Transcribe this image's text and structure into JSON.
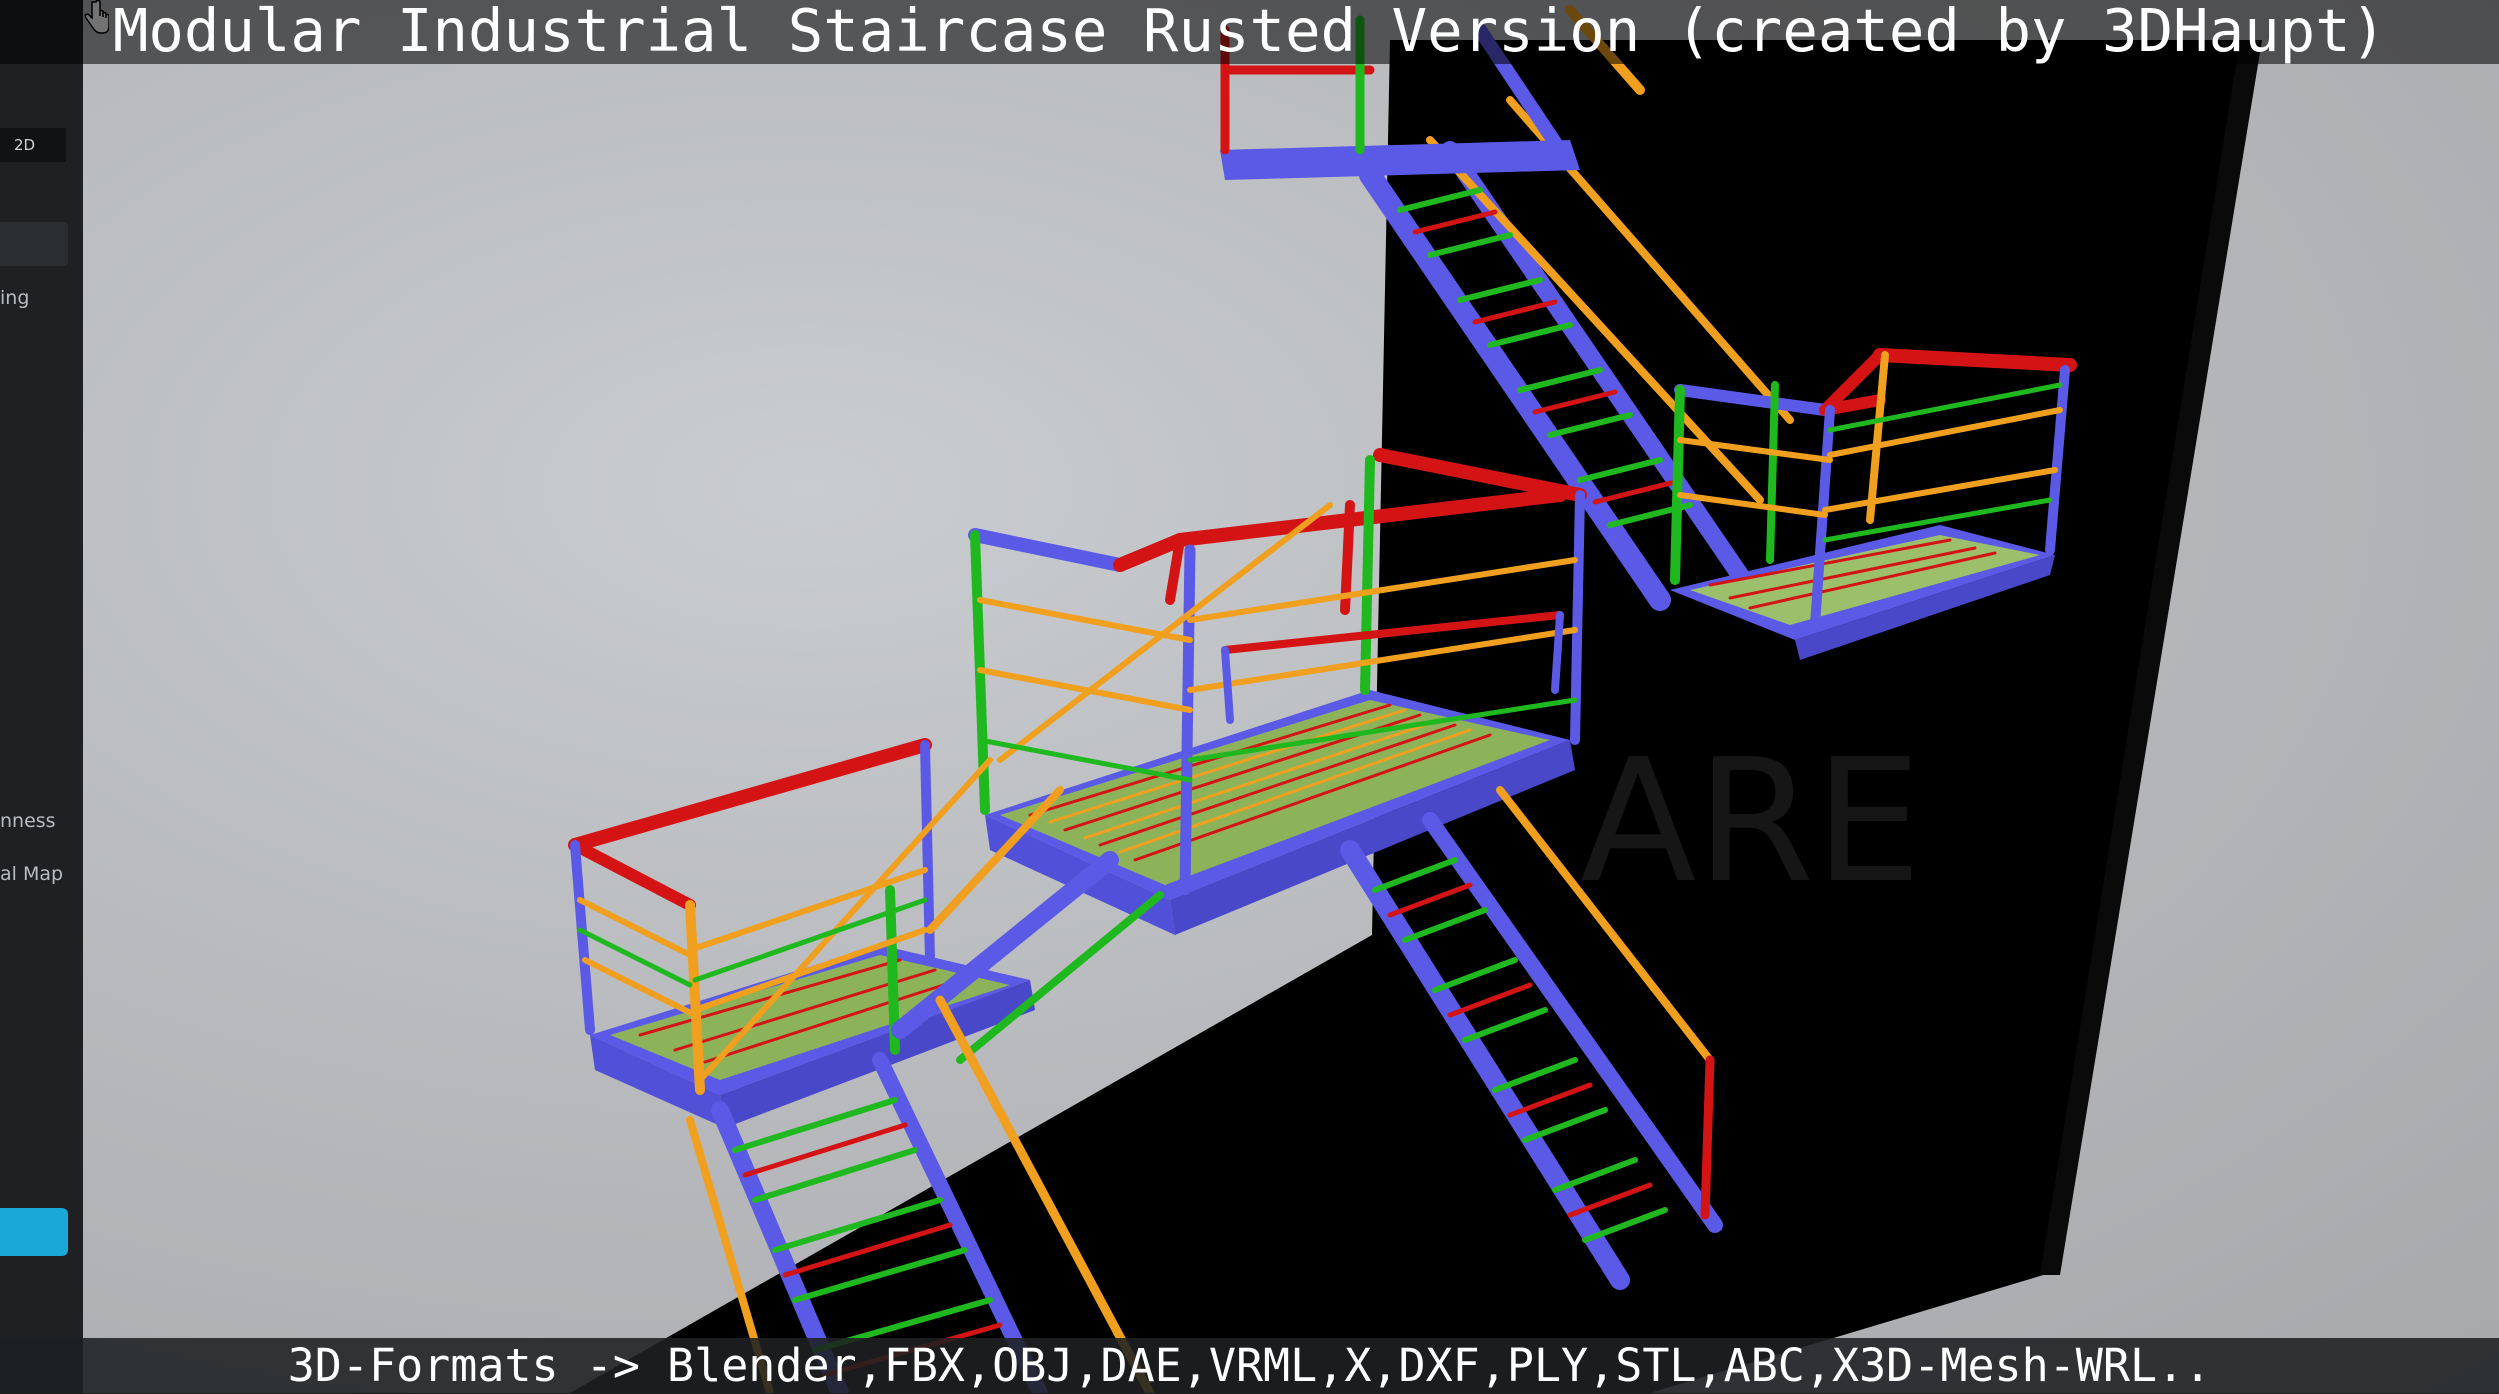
{
  "title": "Modular Industrial Staircase Rusted Version (created by 3DHaupt)",
  "footer": "3D-Formats -> Blender,FBX,OBJ,DAE,VRML,X,DXF,PLY,STL,ABC,X3D-Mesh-WRL..",
  "sidebar": {
    "tab_2d": "2D",
    "labels": [
      "ing",
      "nness",
      "al Map"
    ]
  },
  "viewport": {
    "watermark_text": "ARE",
    "colors": {
      "rail_red": "#d41414",
      "rail_blue": "#5a5ae6",
      "rail_green": "#1fb81f",
      "rail_orange": "#f0a01e",
      "backdrop": "#000000",
      "accent_button": "#1aa8d8"
    }
  },
  "icons": [
    "hand-cursor-icon"
  ]
}
